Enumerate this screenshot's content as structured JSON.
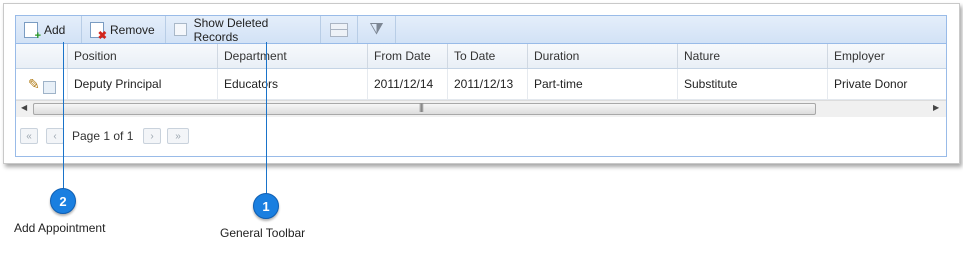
{
  "toolbar": {
    "add_label": "Add",
    "remove_label": "Remove",
    "show_deleted_label": "Show Deleted Records"
  },
  "columns": {
    "position": "Position",
    "department": "Department",
    "from_date": "From Date",
    "to_date": "To Date",
    "duration": "Duration",
    "nature": "Nature",
    "employer": "Employer"
  },
  "rows": [
    {
      "position": "Deputy Principal",
      "department": "Educators",
      "from_date": "2011/12/14",
      "to_date": "2011/12/13",
      "duration": "Part-time",
      "nature": "Substitute",
      "employer": "Private Donor"
    }
  ],
  "pager": {
    "text": "Page 1 of 1"
  },
  "callouts": [
    {
      "number": "2",
      "label": "Add Appointment"
    },
    {
      "number": "1",
      "label": "General Toolbar"
    }
  ],
  "colors": {
    "accent": "#1a7fe0",
    "grid_border": "#99bbe8"
  }
}
